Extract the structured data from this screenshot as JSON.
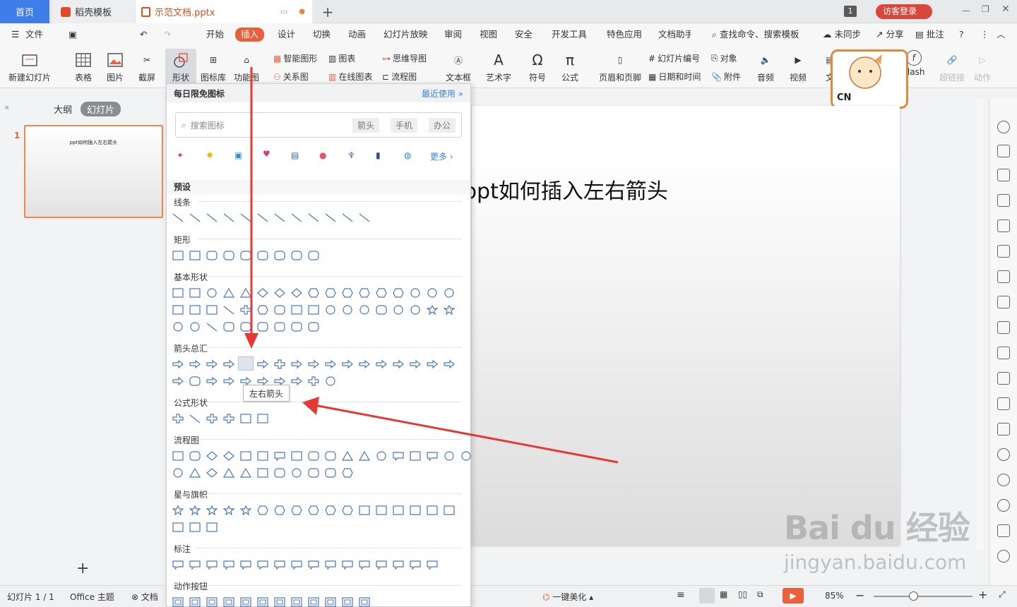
{
  "tabs": {
    "home": "首页",
    "template": "稻壳模板",
    "document": "示范文档.pptx",
    "page_badge": "1",
    "login": "访客登录"
  },
  "menu": {
    "items": [
      "文件",
      "开始",
      "插入",
      "设计",
      "切换",
      "动画",
      "幻灯片放映",
      "审阅",
      "视图",
      "安全",
      "开发工具",
      "特色应用",
      "文档助手"
    ],
    "search": "查找命令、搜索模板",
    "sync": "未同步",
    "share": "分享",
    "comment": "批注"
  },
  "ribbon": {
    "new_slide": "新建幻灯片",
    "table": "表格",
    "picture": "图片",
    "screenshot": "截屏",
    "shape": "形状",
    "icon_lib": "图标库",
    "func_chart": "功能图",
    "smart_shape": "智能图形",
    "chart": "图表",
    "relation": "关系图",
    "online_chart": "在线图表",
    "mindmap": "思维导图",
    "flowchart": "流程图",
    "textbox": "文本框",
    "wordart": "艺术字",
    "symbol": "符号",
    "formula": "公式",
    "header_footer": "页眉和页脚",
    "slide_number": "幻灯片编号",
    "datetime": "日期和时间",
    "object": "对象",
    "attachment": "附件",
    "audio": "音频",
    "video": "视频",
    "text_short": "文",
    "flash": "Flash",
    "hyperlink": "超链接",
    "action": "动作"
  },
  "panel": {
    "outline": "大纲",
    "slides": "幻灯片",
    "slide_index": "1",
    "thumb_title": "ppt如何插入左右箭头"
  },
  "slide": {
    "title": "ppt如何插入左右箭头"
  },
  "dropdown": {
    "header": "每日限免图标",
    "recent": "最近使用",
    "search_placeholder": "搜索图标",
    "chips": [
      "箭头",
      "手机",
      "办公"
    ],
    "more": "更多",
    "preset": "预设",
    "sections": [
      "线条",
      "矩形",
      "基本形状",
      "箭头总汇",
      "公式形状",
      "流程图",
      "星与旗帜",
      "标注",
      "动作按钮"
    ],
    "tooltip": "左右箭头"
  },
  "status": {
    "slide": "幻灯片 1 / 1",
    "theme": "Office 主题",
    "doc_short": "文档",
    "beautify": "一键美化",
    "zoom": "85%"
  },
  "watermark": {
    "brand": "Bai du 经验",
    "url": "jingyan.baidu.com"
  },
  "ime": {
    "label": "CN"
  },
  "colors": {
    "accent": "#e8603c",
    "home_tab": "#3f7ee8",
    "arrow": "#e53935",
    "shape_stroke": "#4a78b8"
  }
}
